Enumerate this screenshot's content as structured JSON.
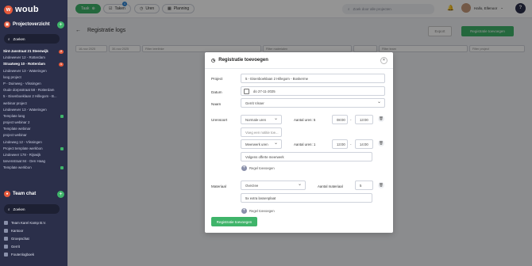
{
  "app": {
    "logo_text": "woub"
  },
  "sidebar": {
    "projects_title": "Projectoverzicht",
    "search_label": "Zoeken",
    "items": [
      {
        "label": "Sint-Janstraat 21 Steenwijk",
        "badge": "2",
        "bold": true,
        "check": false
      },
      {
        "label": "Lindewever 12 - Rotterdam",
        "badge": "",
        "bold": false,
        "check": false
      },
      {
        "label": "Straatweg 10 - Rotterdam",
        "badge": "1",
        "bold": true,
        "check": false
      },
      {
        "label": "Lindewever 13 - Wateringen",
        "badge": "",
        "bold": false,
        "check": false
      },
      {
        "label": "loog project",
        "badge": "",
        "bold": false,
        "check": false
      },
      {
        "label": "P - Duinweg - Vlissingen",
        "badge": "",
        "bold": false,
        "check": false
      },
      {
        "label": "Oude dorpsstraat 58 - Rotterdam",
        "badge": "",
        "bold": false,
        "check": false
      },
      {
        "label": "5 - Eisenboeklaan 2 Hillegom - B...",
        "badge": "",
        "bold": false,
        "check": false
      },
      {
        "label": "webinar project",
        "badge": "",
        "bold": false,
        "check": false
      },
      {
        "label": "Lindewever 13 - Wateringen",
        "badge": "",
        "bold": false,
        "check": false
      },
      {
        "label": "Template lang",
        "badge": "",
        "bold": false,
        "check": true
      },
      {
        "label": "project webinar 2",
        "badge": "",
        "bold": false,
        "check": false
      },
      {
        "label": "Template webinar",
        "badge": "",
        "bold": false,
        "check": false
      },
      {
        "label": "project webinar",
        "badge": "",
        "bold": false,
        "check": false
      },
      {
        "label": "Lindeweg 12 - Vlissingen",
        "badge": "",
        "bold": false,
        "check": false
      },
      {
        "label": "Project template werkbon",
        "badge": "",
        "bold": false,
        "check": true
      },
      {
        "label": "Lindeweer 178 - Rijswijk",
        "badge": "",
        "bold": false,
        "check": false
      },
      {
        "label": "tarvenstraat 84 - Den Haag",
        "badge": "",
        "bold": false,
        "check": false
      },
      {
        "label": "Template werkbon",
        "badge": "",
        "bold": false,
        "check": true
      }
    ],
    "chat_title": "Team chat",
    "chat_search_label": "Zoeken",
    "chats": [
      {
        "label": "Team Karel Kamp B.V."
      },
      {
        "label": "Kantoor"
      },
      {
        "label": "Groepschat"
      },
      {
        "label": "Gerrit"
      },
      {
        "label": "Foutenlogboek"
      }
    ]
  },
  "topbar": {
    "task_label": "Taak",
    "tasks_label": "Taken",
    "tasks_badge": "4",
    "hours_label": "Uren",
    "planning_label": "Planning",
    "search_placeholder": "Zoek door alle projecten",
    "user_greeting": "Hallo, Ellenoor",
    "help_label": "?"
  },
  "page": {
    "title": "Registratie logs",
    "export_label": "Export",
    "add_label": "Registratie toevoegen",
    "filters": [
      "16-nov 2025",
      "30-nov 2025",
      "Filter leerlinke",
      "Filter materialen",
      "",
      "Filter team",
      "Filter project"
    ]
  },
  "modal": {
    "title": "Registratie toevoegen",
    "project_label": "Project",
    "project_value": "5 - Eisenboeklaan 2 Hillegom - Boskerme",
    "date_label": "Datum",
    "date_value": "do 27-11-2025",
    "name_label": "Naam",
    "name_value": "Gerrit Visser",
    "hours_type_label": "Urensoort",
    "hour_rows": [
      {
        "type": "Normale uren",
        "count_label": "Aantal uren: 5",
        "start": "08:00",
        "end": "13:00",
        "note_placeholder": "Voeg een notitie toe..."
      },
      {
        "type": "Meerwerk uren",
        "count_label": "Aantal uren: 1",
        "start": "13:00",
        "end": "14:00",
        "note_placeholder": "Volgens offerte meerwerk"
      }
    ],
    "add_row_label": "Regel toevoegen",
    "material_label": "Materiaal",
    "material_value": "Overzee",
    "material_count_label": "Aantal materiaal",
    "material_count": "5",
    "material_note": "5x extra lassenplaat",
    "add_material_label": "Regel toevoegen",
    "submit_label": "Registratie toevoegen"
  }
}
